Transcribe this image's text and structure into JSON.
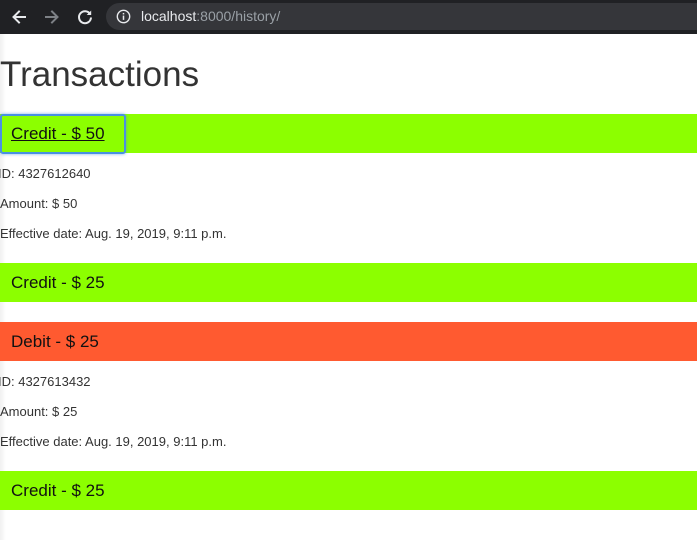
{
  "browser": {
    "url_host": "localhost",
    "url_rest": ":8000/history/"
  },
  "page": {
    "title": "Transactions"
  },
  "transactions": [
    {
      "label": "Credit - $ 50",
      "type": "credit",
      "expanded": true,
      "focused": true,
      "details": {
        "id": "ID: 4327612640",
        "amount": "Amount: $ 50",
        "effective_date": "Effective date: Aug. 19, 2019, 9:11 p.m."
      }
    },
    {
      "label": "Credit - $ 25",
      "type": "credit",
      "expanded": false
    },
    {
      "label": "Debit - $ 25",
      "type": "debit",
      "expanded": true,
      "details": {
        "id": "ID: 4327613432",
        "amount": "Amount: $ 25",
        "effective_date": "Effective date: Aug. 19, 2019, 9:11 p.m."
      }
    },
    {
      "label": "Credit - $ 25",
      "type": "credit",
      "expanded": false
    }
  ],
  "colors": {
    "credit": "#8cff00",
    "debit": "#ff5a30",
    "focus": "#4a90e2"
  }
}
